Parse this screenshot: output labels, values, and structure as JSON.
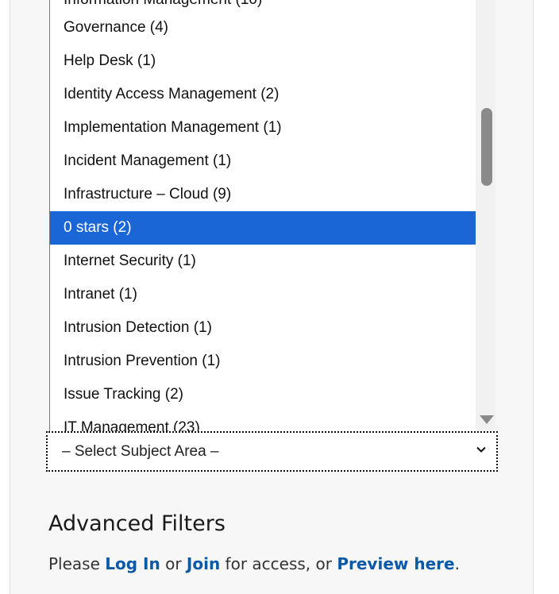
{
  "dropdown": {
    "options": [
      "Governance (4)",
      "Help Desk (1)",
      "Identity Access Management (2)",
      "Implementation Management (1)",
      "Incident Management (1)",
      "Infrastructure – Cloud (9)",
      "0 stars (2)",
      "Internet Security (1)",
      "Intranet (1)",
      "Intrusion Detection (1)",
      "Intrusion Prevention (1)",
      "Issue Tracking (2)",
      "IT Management (23)"
    ],
    "selected_index": 6
  },
  "select": {
    "value": "– Select Subject Area –"
  },
  "advanced": {
    "title": "Advanced Filters",
    "text_please": "Please",
    "login_link": "Log In",
    "text_or": "or",
    "join_link": "Join",
    "text_access": "for access, or",
    "preview_link": "Preview here",
    "text_period": "."
  },
  "colors": {
    "selected_bg": "#1a66d6",
    "link": "#0a5aa8"
  }
}
